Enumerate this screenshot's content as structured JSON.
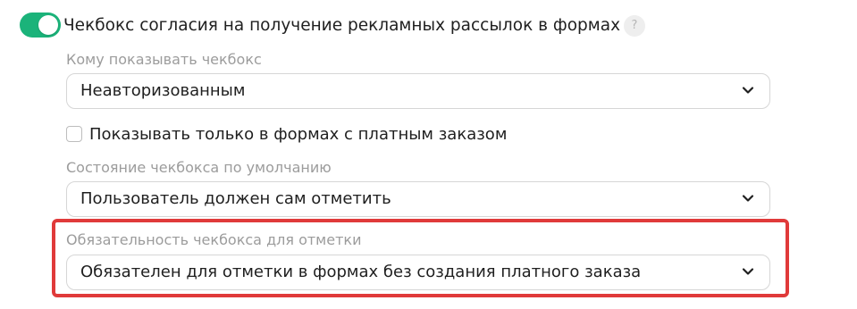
{
  "consent": {
    "enabled": true,
    "title": "Чекбокс согласия на получение рекламных рассылок в формах",
    "help_label": "?"
  },
  "who_to_show": {
    "label": "Кому показывать чекбокс",
    "value": "Неавторизованным"
  },
  "paid_only": {
    "checked": false,
    "label": "Показывать только в формах с платным заказом"
  },
  "default_state": {
    "label": "Состояние чекбокса по умолчанию",
    "value": "Пользователь должен сам отметить"
  },
  "required": {
    "label": "Обязательность чекбокса для отметки",
    "value": "Обязателен для отметки в формах без создания платного заказа"
  },
  "colors": {
    "toggle_on": "#1bb37a",
    "highlight": "#e03a3a",
    "label_gray": "#9c9c9c"
  },
  "icons": {
    "select_arrow": "chevron-down-icon",
    "help": "question-icon"
  }
}
